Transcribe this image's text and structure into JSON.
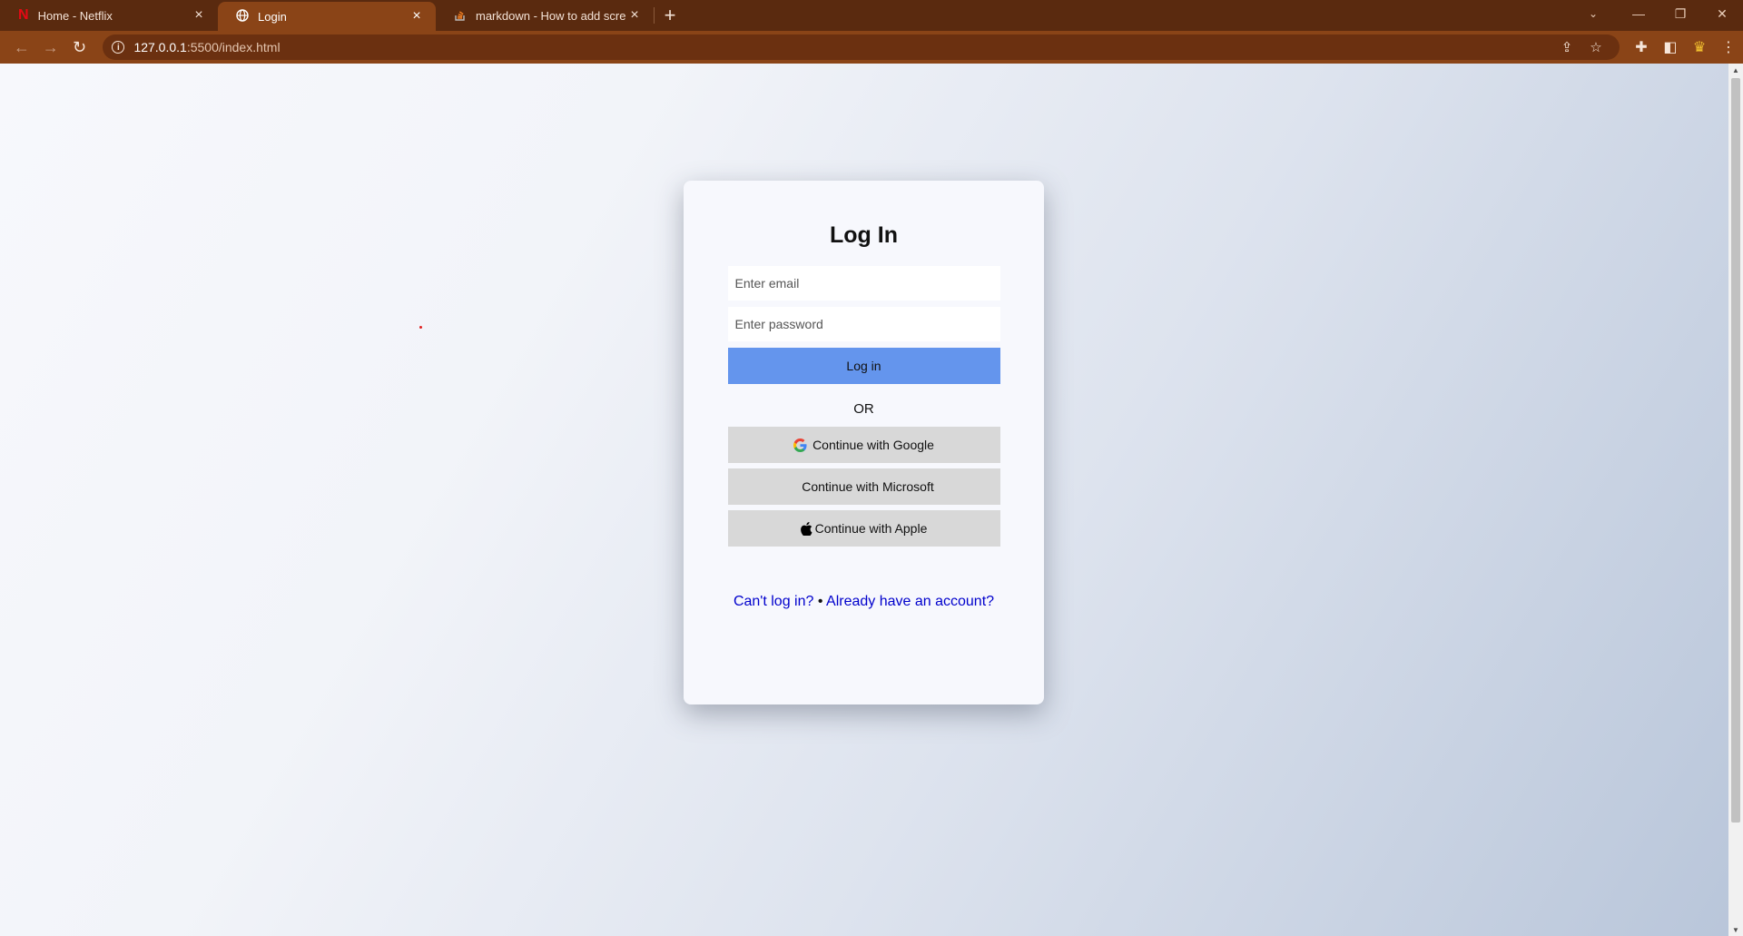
{
  "browser": {
    "tabs": [
      {
        "label": "Home - Netflix",
        "icon": "netflix-icon",
        "active": false
      },
      {
        "label": "Login",
        "icon": "globe-icon",
        "active": true
      },
      {
        "label": "markdown - How to add screens",
        "icon": "stackoverflow-icon",
        "active": false
      }
    ],
    "url_host": "127.0.0.1",
    "url_path": ":5500/index.html",
    "colors": {
      "tabbar": "#5a2a0f",
      "toolbar": "#8a4417"
    }
  },
  "login": {
    "title": "Log In",
    "email_placeholder": "Enter email",
    "password_placeholder": "Enter password",
    "login_button": "Log in",
    "or_text": "OR",
    "google_button": "Continue with Google",
    "microsoft_button": "Continue with Microsoft",
    "apple_button": "Continue with Apple",
    "cant_login_link": "Can't log in?",
    "separator": "•",
    "account_link": "Already have an account?",
    "colors": {
      "login_button": "#6495ed",
      "oauth_button": "#d8d8d8",
      "link": "#0000cc"
    }
  }
}
